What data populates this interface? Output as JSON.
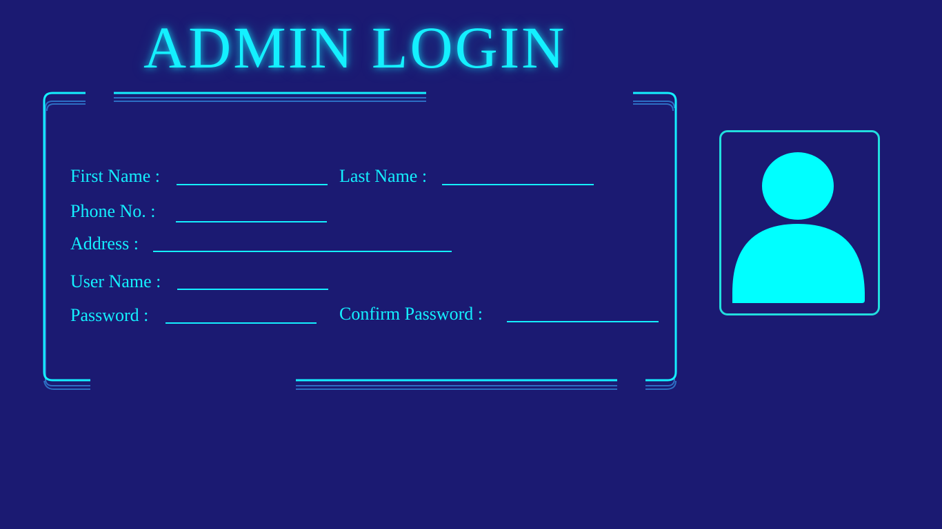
{
  "page": {
    "title": "ADMIN LOGIN"
  },
  "form": {
    "first_name_label": "First Name :",
    "first_name_value": "",
    "last_name_label": "Last Name :",
    "last_name_value": "",
    "phone_label": "Phone No. :",
    "phone_value": "",
    "address_label": "Address :",
    "address_value": "",
    "username_label": "User Name :",
    "username_value": "",
    "password_label": "Password :",
    "password_value": "",
    "confirm_password_label": "Confirm Password :",
    "confirm_password_value": ""
  },
  "avatar": {
    "icon": "user-silhouette-icon"
  },
  "colors": {
    "background": "#1b1a72",
    "accent": "#14f0ff",
    "frame_shadow": "#2d6fc4",
    "avatar_border": "#22dede",
    "avatar_fill": "#00ffff"
  }
}
